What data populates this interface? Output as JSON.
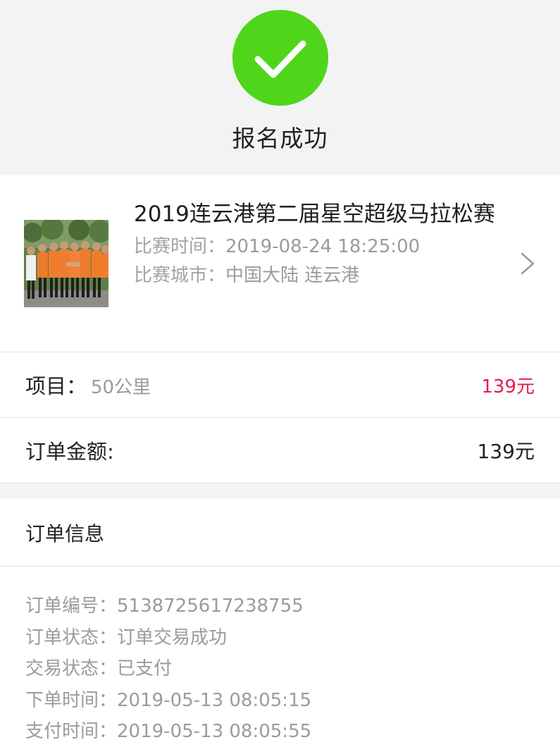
{
  "header": {
    "status_title": "报名成功",
    "check_color": "#4fd61a",
    "icon": "check-icon"
  },
  "event": {
    "name": "2019连云港第二届星空超级马拉松赛",
    "time_label": "比赛时间：",
    "time_value": "2019-08-24 18:25:00",
    "city_label": "比赛城市：",
    "city_value": "中国大陆 连云港",
    "thumbnail": "event-photo",
    "chevron_icon": "chevron-right-icon"
  },
  "item_row": {
    "label": "项目：",
    "value": "50公里",
    "price": "139元",
    "price_color": "#e8194f"
  },
  "amount_row": {
    "label": "订单金额:",
    "value": "139元"
  },
  "order_info": {
    "title": "订单信息",
    "lines": [
      {
        "label": "订单编号：",
        "value": "5138725617238755"
      },
      {
        "label": "订单状态：",
        "value": "订单交易成功"
      },
      {
        "label": "交易状态：",
        "value": "已支付"
      },
      {
        "label": "下单时间：",
        "value": "2019-05-13 08:05:15"
      },
      {
        "label": "支付时间：",
        "value": "2019-05-13 08:05:55"
      }
    ]
  }
}
